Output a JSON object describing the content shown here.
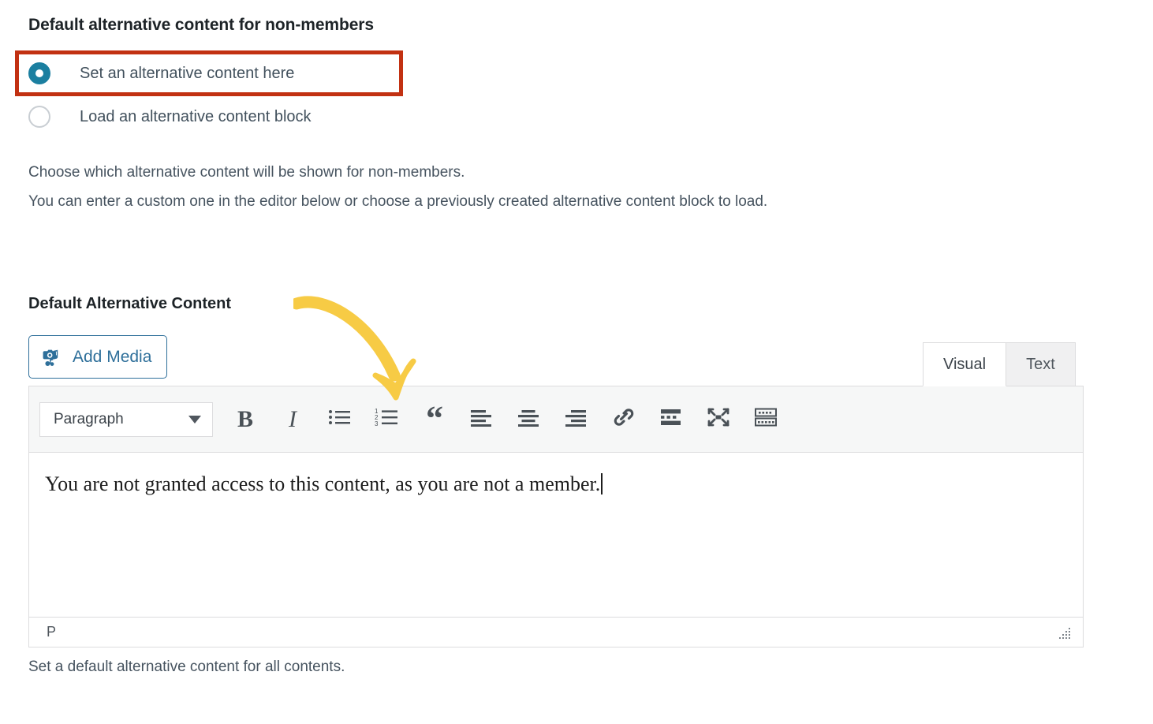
{
  "section": {
    "heading": "Default alternative content for non-members"
  },
  "radio_group": {
    "options": [
      {
        "label": "Set an alternative content here",
        "selected": true,
        "highlighted": true
      },
      {
        "label": "Load an alternative content block",
        "selected": false,
        "highlighted": false
      }
    ]
  },
  "description": {
    "line1": "Choose which alternative content will be shown for non-members.",
    "line2": "You can enter a custom one in the editor below or choose a previously created alternative content block to load."
  },
  "field": {
    "label": "Default Alternative Content",
    "help_text": "Set a default alternative content for all contents."
  },
  "add_media": {
    "label": "Add Media",
    "icon": "media-camera-music-icon"
  },
  "editor": {
    "tabs": [
      {
        "label": "Visual",
        "active": true
      },
      {
        "label": "Text",
        "active": false
      }
    ],
    "toolbar": {
      "format_select": {
        "value": "Paragraph",
        "caret_icon": "chevron-down-icon"
      },
      "buttons": [
        {
          "name": "bold-button",
          "glyph": "B",
          "title": "Bold"
        },
        {
          "name": "italic-button",
          "glyph": "I",
          "title": "Italic"
        },
        {
          "name": "bulleted-list-button",
          "icon": "bulleted-list-icon"
        },
        {
          "name": "numbered-list-button",
          "icon": "numbered-list-icon"
        },
        {
          "name": "blockquote-button",
          "glyph": "“",
          "title": "Blockquote"
        },
        {
          "name": "align-left-button",
          "icon": "align-left-icon"
        },
        {
          "name": "align-center-button",
          "icon": "align-center-icon"
        },
        {
          "name": "align-right-button",
          "icon": "align-right-icon"
        },
        {
          "name": "insert-link-button",
          "icon": "link-icon"
        },
        {
          "name": "insert-read-more-button",
          "icon": "read-more-icon"
        },
        {
          "name": "fullscreen-button",
          "icon": "fullscreen-expand-icon"
        },
        {
          "name": "keyboard-shortcuts-button",
          "icon": "keyboard-icon"
        }
      ]
    },
    "content": {
      "paragraph": "You are not granted access to this content, as you are not a member.",
      "cursor_visible": true
    },
    "status": {
      "path": "P",
      "resize_handle": "resize-grip-icon"
    }
  },
  "annotation": {
    "arrow": "curved-arrow-annotation",
    "arrow_color": "#f7cb45",
    "highlight_box_color": "#c23112"
  },
  "colors": {
    "radio_selected": "#1b7fa0",
    "link_blue": "#2e6f9a",
    "heading": "#1d2327",
    "body_text": "#46535f",
    "toolbar_bg": "#f6f7f7",
    "border": "#dcdcde",
    "tab_inactive_bg": "#f0f0f1"
  }
}
